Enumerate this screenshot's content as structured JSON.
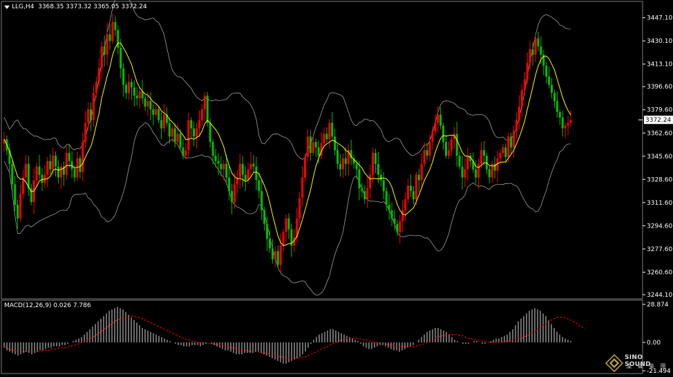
{
  "header": {
    "symbol": "LLG,H4",
    "ohlc": "3368.35 3373.32 3365.05 3372.24"
  },
  "macd_header": {
    "label": "MACD(12,26,9) 0.026 7.786"
  },
  "logo": {
    "brand": "SINO SOUND",
    "sub": "漢 聲 集 團"
  },
  "colors": {
    "background": "#000000",
    "bull": "#ff0000",
    "bear": "#00c000",
    "ma": "#ffff00",
    "bands": "#a0a0a0",
    "macd_hist": "#d8d8d8",
    "macd_signal": "#ff0000",
    "price_tag_bg": "#ffffff",
    "axis_text": "#ffffff"
  },
  "chart_data": [
    {
      "type": "candlestick",
      "symbol": "LLG",
      "timeframe": "H4",
      "price_axis_ticks": [
        "3447.10",
        "3430.10",
        "3413.10",
        "3396.60",
        "3379.60",
        "3362.60",
        "3345.60",
        "3328.60",
        "3311.60",
        "3294.60",
        "3277.60",
        "3260.60",
        "3244.10"
      ],
      "ylim": [
        3244.1,
        3455
      ],
      "current_price": "3372.24",
      "overlays": [
        "Bollinger Bands",
        "Moving Average"
      ],
      "closes": [
        3358,
        3350,
        3340,
        3325,
        3310,
        3300,
        3318,
        3330,
        3340,
        3322,
        3312,
        3328,
        3338,
        3332,
        3326,
        3332,
        3342,
        3336,
        3346,
        3338,
        3330,
        3338,
        3332,
        3348,
        3342,
        3336,
        3330,
        3344,
        3334,
        3356,
        3370,
        3380,
        3372,
        3392,
        3400,
        3410,
        3426,
        3420,
        3435,
        3430,
        3444,
        3438,
        3425,
        3410,
        3398,
        3392,
        3400,
        3396,
        3390,
        3388,
        3393,
        3388,
        3382,
        3386,
        3380,
        3376,
        3380,
        3372,
        3366,
        3376,
        3370,
        3360,
        3366,
        3356,
        3362,
        3352,
        3346,
        3350,
        3372,
        3366,
        3360,
        3366,
        3372,
        3380,
        3390,
        3370,
        3356,
        3346,
        3342,
        3340,
        3336,
        3340,
        3330,
        3320,
        3312,
        3325,
        3330,
        3340,
        3332,
        3328,
        3336,
        3340,
        3338,
        3328,
        3320,
        3306,
        3296,
        3285,
        3278,
        3270,
        3276,
        3266,
        3280,
        3290,
        3300,
        3292,
        3280,
        3286,
        3300,
        3315,
        3330,
        3345,
        3360,
        3348,
        3356,
        3352,
        3346,
        3355,
        3362,
        3358,
        3370,
        3360,
        3350,
        3340,
        3336,
        3344,
        3340,
        3350,
        3344,
        3340,
        3336,
        3322,
        3320,
        3314,
        3322,
        3332,
        3348,
        3340,
        3332,
        3328,
        3320,
        3310,
        3306,
        3300,
        3296,
        3290,
        3298,
        3306,
        3314,
        3324,
        3320,
        3314,
        3332,
        3328,
        3340,
        3350,
        3346,
        3356,
        3364,
        3370,
        3376,
        3368,
        3356,
        3346,
        3350,
        3358,
        3362,
        3346,
        3338,
        3330,
        3336,
        3346,
        3342,
        3336,
        3330,
        3340,
        3350,
        3346,
        3336,
        3330,
        3340,
        3335,
        3344,
        3348,
        3352,
        3345,
        3360,
        3352,
        3364,
        3372,
        3382,
        3394,
        3402,
        3414,
        3424,
        3420,
        3432,
        3426,
        3420,
        3412,
        3404,
        3398,
        3392,
        3386,
        3378,
        3374,
        3366,
        3368,
        3370,
        3372.24
      ]
    },
    {
      "type": "bar",
      "indicator": "MACD",
      "params": [
        12,
        26,
        9
      ],
      "values_label": [
        "0.026",
        "7.786"
      ],
      "axis_ticks": [
        "28.874",
        "0.00",
        "-21.494"
      ],
      "ylim": [
        -21.494,
        28.874
      ],
      "main": [
        -4,
        -6,
        -7,
        -8,
        -9,
        -10,
        -9,
        -8,
        -7,
        -8,
        -9,
        -8,
        -7,
        -6,
        -6,
        -5,
        -4,
        -4,
        -3,
        -3,
        -3,
        -2,
        -2,
        -1,
        0,
        1,
        2,
        3,
        4,
        6,
        8,
        10,
        12,
        14,
        16,
        18,
        20,
        22,
        24,
        25,
        26,
        27,
        26,
        25,
        23,
        21,
        19,
        17,
        15,
        13,
        11,
        10,
        9,
        8,
        7,
        6,
        5,
        4,
        3,
        2,
        1,
        0,
        -1,
        -2,
        -2,
        -3,
        -3,
        -3,
        -2,
        -2,
        -2,
        -3,
        -2,
        -1,
        0,
        -1,
        -2,
        -3,
        -4,
        -5,
        -6,
        -6,
        -7,
        -8,
        -9,
        -9,
        -9,
        -8,
        -8,
        -8,
        -8,
        -7,
        -7,
        -8,
        -9,
        -10,
        -11,
        -12,
        -13,
        -14,
        -15,
        -16,
        -16,
        -15,
        -14,
        -13,
        -12,
        -11,
        -9,
        -7,
        -4,
        -1,
        2,
        4,
        6,
        7,
        8,
        9,
        10,
        10,
        9,
        8,
        7,
        6,
        5,
        4,
        3,
        2,
        1,
        -1,
        -3,
        -4,
        -5,
        -5,
        -4,
        -3,
        -2,
        -2,
        -3,
        -4,
        -5,
        -6,
        -6,
        -7,
        -6,
        -5,
        -4,
        -3,
        -2,
        0,
        2,
        4,
        6,
        8,
        9,
        10,
        11,
        11,
        10,
        9,
        8,
        6,
        4,
        2,
        1,
        0,
        -1,
        -1,
        -1,
        0,
        1,
        1,
        0,
        -1,
        -1,
        0,
        1,
        2,
        3,
        3,
        4,
        5,
        6,
        8,
        10,
        13,
        16,
        18,
        20,
        22,
        24,
        25,
        26,
        25,
        24,
        22,
        20,
        17,
        14,
        11,
        8,
        6,
        4,
        3,
        2,
        1
      ],
      "signal": [
        -3,
        -4,
        -5,
        -6,
        -6,
        -7,
        -7,
        -7,
        -7,
        -7,
        -7,
        -7,
        -7,
        -7,
        -6,
        -6,
        -6,
        -5,
        -5,
        -5,
        -4,
        -4,
        -4,
        -3,
        -3,
        -2,
        -2,
        -1,
        0,
        1,
        2,
        3,
        4,
        5,
        7,
        8,
        10,
        11,
        13,
        14,
        16,
        17,
        18,
        19,
        19,
        20,
        20,
        20,
        19,
        19,
        18,
        17,
        16,
        15,
        14,
        13,
        12,
        11,
        10,
        9,
        8,
        7,
        6,
        5,
        4,
        3,
        2,
        2,
        1,
        1,
        0,
        0,
        0,
        -1,
        -1,
        -1,
        -1,
        -2,
        -2,
        -2,
        -3,
        -3,
        -4,
        -4,
        -5,
        -5,
        -6,
        -6,
        -6,
        -7,
        -7,
        -7,
        -7,
        -8,
        -8,
        -8,
        -9,
        -9,
        -10,
        -10,
        -11,
        -11,
        -12,
        -12,
        -12,
        -12,
        -12,
        -12,
        -11,
        -11,
        -10,
        -9,
        -8,
        -7,
        -6,
        -5,
        -4,
        -3,
        -2,
        -1,
        0,
        1,
        2,
        2,
        3,
        3,
        3,
        3,
        3,
        3,
        2,
        2,
        1,
        1,
        0,
        0,
        -1,
        -1,
        -1,
        -2,
        -2,
        -2,
        -3,
        -3,
        -3,
        -3,
        -3,
        -3,
        -3,
        -3,
        -2,
        -2,
        -1,
        0,
        1,
        2,
        3,
        4,
        5,
        5,
        6,
        6,
        6,
        6,
        6,
        5,
        5,
        4,
        3,
        3,
        2,
        2,
        1,
        1,
        1,
        0,
        0,
        0,
        0,
        0,
        0,
        1,
        1,
        1,
        2,
        2,
        3,
        3,
        4,
        5,
        6,
        7,
        8,
        10,
        11,
        13,
        14,
        16,
        17,
        18,
        19,
        19,
        19,
        19,
        18,
        17,
        16,
        15,
        13,
        12,
        10
      ]
    }
  ]
}
